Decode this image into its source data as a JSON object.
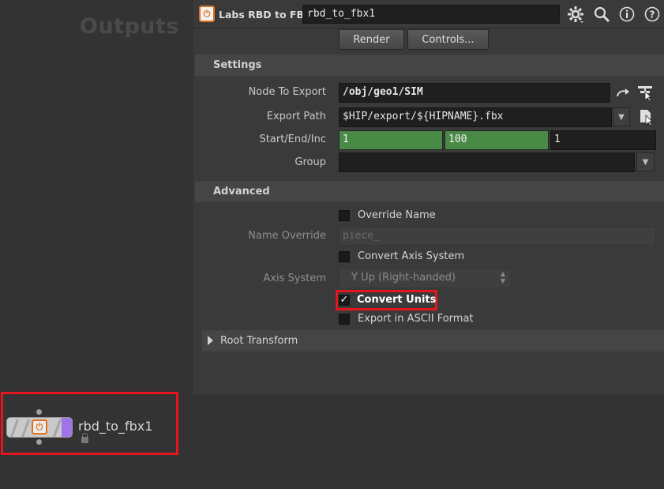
{
  "network": {
    "title": "Outputs",
    "node": {
      "label": "rbd_to_fbx1",
      "icon": "rbd-to-fbx-icon",
      "lock_icon": "lock-icon",
      "flag_color": "#a173e8"
    }
  },
  "header": {
    "op_type": "Labs RBD to FBX",
    "op_icon": "labs-node-icon",
    "node_name": "rbd_to_fbx1",
    "icons": [
      "gear-icon",
      "search-icon",
      "info-icon",
      "help-icon"
    ]
  },
  "buttons": {
    "render": "Render",
    "controls": "Controls..."
  },
  "settings": {
    "title": "Settings",
    "node_to_export": {
      "label": "Node To Export",
      "value": "/obj/geo1/SIM"
    },
    "export_path": {
      "label": "Export Path",
      "value": "$HIP/export/${HIPNAME}.fbx"
    },
    "start_end_inc": {
      "label": "Start/End/Inc",
      "start": "1",
      "end": "100",
      "inc": "1"
    },
    "group": {
      "label": "Group",
      "value": ""
    }
  },
  "advanced": {
    "title": "Advanced",
    "override_name": {
      "label": "Override Name",
      "checked": false
    },
    "name_override": {
      "label": "Name Override",
      "placeholder": "piece_"
    },
    "convert_axis": {
      "label": "Convert Axis System",
      "checked": false
    },
    "axis_system": {
      "label": "Axis System",
      "value": "Y Up (Right-handed)"
    },
    "convert_units": {
      "label": "Convert Units",
      "checked": true,
      "mark": "✓"
    },
    "ascii": {
      "label": "Export in ASCII Format",
      "checked": false
    },
    "root_transform": {
      "label": "Root Transform"
    }
  },
  "colors": {
    "accent_orange": "#e0701b",
    "highlight_red": "#e5151d",
    "frame_green": "#4a8a47"
  }
}
